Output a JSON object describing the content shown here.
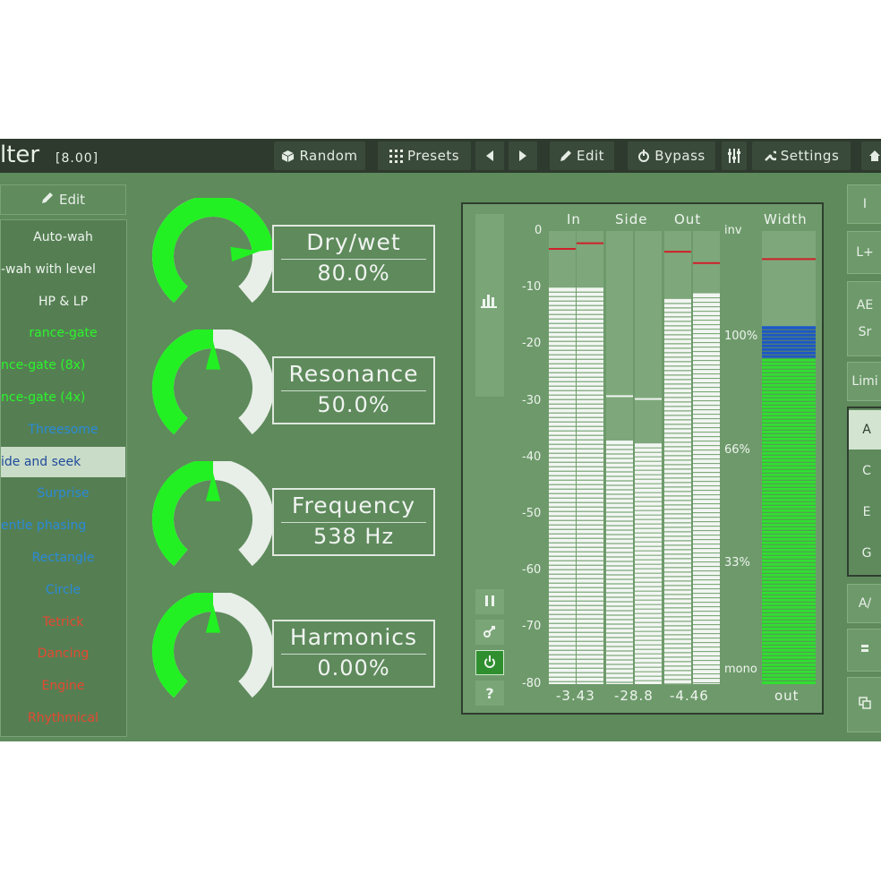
{
  "header": {
    "title": "lter",
    "version": "[8.00]",
    "random_label": "Random",
    "presets_label": "Presets",
    "edit_label": "Edit",
    "bypass_label": "Bypass",
    "settings_label": "Settings"
  },
  "sidebar": {
    "edit_label": "Edit",
    "presets": [
      {
        "label": "Auto-wah",
        "color": "#eef4ee",
        "selected": false
      },
      {
        "label": "-wah with level",
        "color": "#eef4ee",
        "selected": false
      },
      {
        "label": "HP & LP",
        "color": "#eef4ee",
        "selected": false
      },
      {
        "label": "rance-gate",
        "color": "#2cf52c",
        "selected": false
      },
      {
        "label": "nce-gate (8x)",
        "color": "#2cf52c",
        "selected": false
      },
      {
        "label": "nce-gate (4x)",
        "color": "#2cf52c",
        "selected": false
      },
      {
        "label": "Threesome",
        "color": "#2a8ad8",
        "selected": false
      },
      {
        "label": "ide and seek",
        "color": "#1f4a9c",
        "selected": true
      },
      {
        "label": "Surprise",
        "color": "#2a8ad8",
        "selected": false
      },
      {
        "label": "entle phasing",
        "color": "#2a8ad8",
        "selected": false
      },
      {
        "label": "Rectangle",
        "color": "#2a8ad8",
        "selected": false
      },
      {
        "label": "Circle",
        "color": "#2a8ad8",
        "selected": false
      },
      {
        "label": "Tetrick",
        "color": "#e64830",
        "selected": false
      },
      {
        "label": "Dancing",
        "color": "#e64830",
        "selected": false
      },
      {
        "label": "Engine",
        "color": "#e64830",
        "selected": false
      },
      {
        "label": "Rhythmical",
        "color": "#e64830",
        "selected": false
      }
    ]
  },
  "knobs": [
    {
      "name": "Dry/wet",
      "value": "80.0%",
      "fraction": 0.8
    },
    {
      "name": "Resonance",
      "value": "50.0%",
      "fraction": 0.5
    },
    {
      "name": "Frequency",
      "value": "538 Hz",
      "fraction": 0.5
    },
    {
      "name": "Harmonics",
      "value": "0.00%",
      "fraction": 0.5
    }
  ],
  "meter": {
    "headers": {
      "in": "In",
      "side": "Side",
      "out": "Out",
      "width": "Width"
    },
    "db_scale": [
      "0",
      "-10",
      "-20",
      "-30",
      "-40",
      "-50",
      "-60",
      "-70",
      "-80"
    ],
    "width_scale": [
      "inv",
      "100%",
      "66%",
      "33%",
      "mono"
    ],
    "readouts": {
      "in": "-3.43",
      "side": "-28.8",
      "out": "-4.46",
      "width": "out"
    },
    "levels_db": {
      "in_l": -10,
      "in_r": -10,
      "side_l": -37,
      "side_r": -37.5,
      "out_l": -12,
      "out_r": -11
    },
    "peaks_db": {
      "in_l": -3,
      "in_r": -2,
      "side_l": -29,
      "side_r": -29.5,
      "out_l": -3.5,
      "out_r": -5.5
    },
    "width_fill": 0.72,
    "width_blue": 0.07,
    "width_peak": 0.94
  },
  "right_panel": {
    "items": [
      "I",
      "L+",
      "AE",
      "Sr",
      "Limi",
      "A",
      "C",
      "E",
      "G",
      "A/",
      "",
      ""
    ]
  },
  "colors": {
    "background": "#5e8a5c",
    "knob_green": "#22f022",
    "knob_track": "#e8eee8",
    "topbar": "#2d3a2d",
    "meter_bar": "#f2f6f2",
    "width_green": "#30e030",
    "width_blue": "#1d57c8",
    "peak_red": "#d0202a"
  }
}
